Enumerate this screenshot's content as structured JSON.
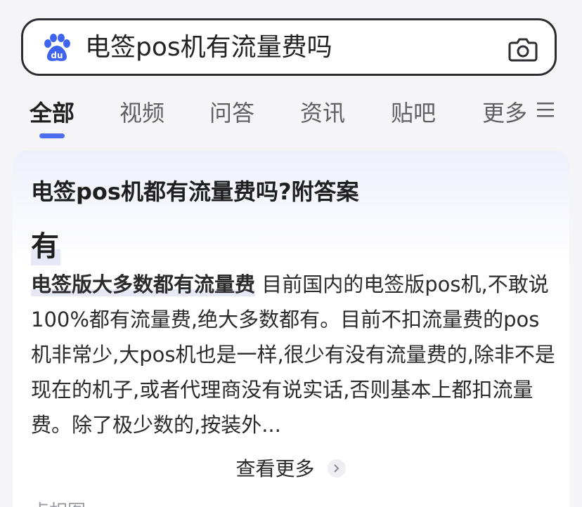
{
  "search": {
    "query": "电签pos机有流量费吗",
    "logo_icon": "baidu-paw-logo",
    "camera_icon": "camera-icon"
  },
  "tabs": [
    {
      "label": "全部",
      "active": true
    },
    {
      "label": "视频",
      "active": false
    },
    {
      "label": "问答",
      "active": false
    },
    {
      "label": "资讯",
      "active": false
    },
    {
      "label": "贴吧",
      "active": false
    },
    {
      "label": "更多",
      "active": false
    }
  ],
  "menu_icon": "hamburger-menu-icon",
  "result": {
    "title": "电签pos机都有流量费吗?附答案",
    "answer": "有",
    "highlight": "电签版大多数都有流量费",
    "body": " 目前国内的电签版pos机,不敢说100%都有流量费,绝大多数都有。目前不扣流量费的pos机非常少,大pos机也是一样,很少有没有流量费的,除非不是现在的机子,或者代理商没有说实话,否则基本上都扣流量费。除了极少数的,按装外...",
    "view_more": "查看更多"
  },
  "bottom_partial_text": "点相图",
  "colors": {
    "accent": "#4e6ef2",
    "text": "#1f1f1f",
    "muted": "#5f5f66"
  }
}
